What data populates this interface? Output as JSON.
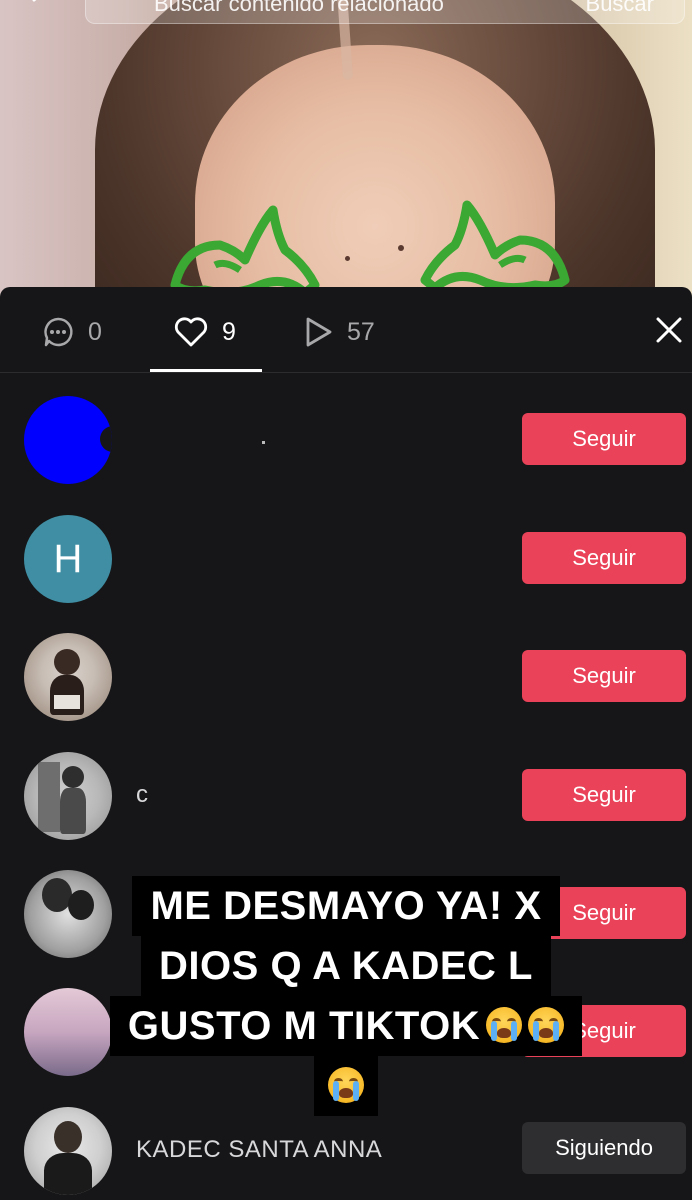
{
  "search": {
    "placeholder": "Buscar contenido relacionado",
    "button_label": "Buscar"
  },
  "tabs": [
    {
      "icon": "comment-icon",
      "count": "0"
    },
    {
      "icon": "heart-icon",
      "count": "9"
    },
    {
      "icon": "play-icon",
      "count": "57"
    }
  ],
  "active_tab_index": 1,
  "users": [
    {
      "name": "",
      "action": "Seguir",
      "avatar": "blue-circle"
    },
    {
      "name": "",
      "action": "Seguir",
      "avatar_letter": "H"
    },
    {
      "name": "",
      "action": "Seguir",
      "avatar": "photo"
    },
    {
      "name": "c",
      "action": "Seguir",
      "avatar": "photo"
    },
    {
      "name": "",
      "action": "Seguir",
      "avatar": "photo"
    },
    {
      "name": "",
      "action": "Seguir",
      "avatar": "photo"
    },
    {
      "name": "KADEC SANTA ANNA",
      "action": "Siguiendo",
      "avatar": "photo"
    }
  ],
  "caption": {
    "line1": "ME DESMAYO YA! X",
    "line2": "DIOS Q A KADEC L",
    "line3": "GUSTO M TIKTOK"
  },
  "colors": {
    "follow": "#ea4359",
    "following": "#2e2e30",
    "sheet": "#161618"
  }
}
